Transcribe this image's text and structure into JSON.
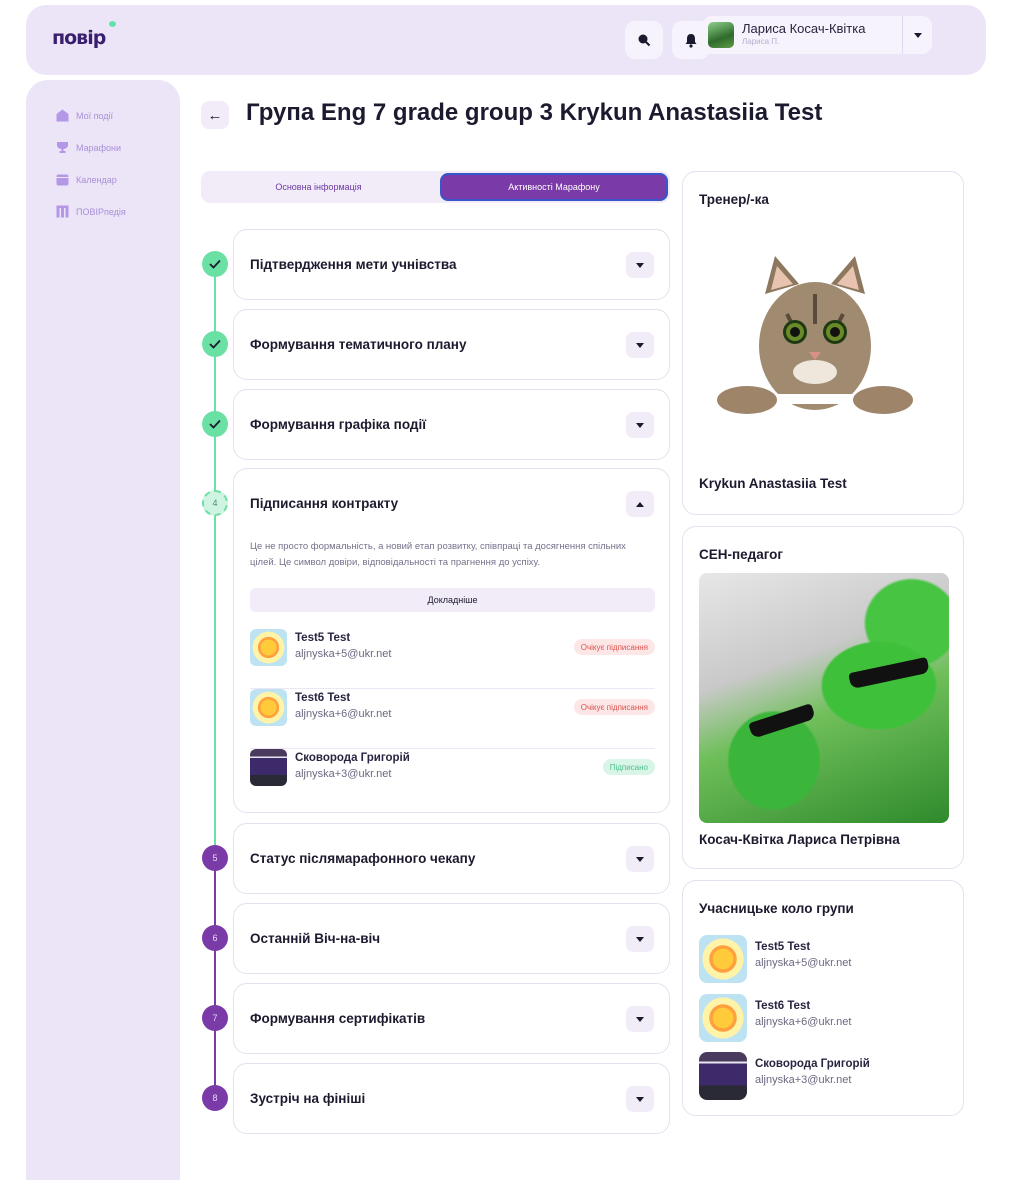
{
  "header": {
    "logo_text": "повір",
    "search_icon": "search-icon",
    "bell_icon": "bell-icon",
    "user_name": "Лариса Косач-Квітка",
    "user_short": "Лариса П."
  },
  "sidebar": {
    "items": [
      {
        "label": "Мої події",
        "icon": "home-icon"
      },
      {
        "label": "Марафони",
        "icon": "trophy-icon"
      },
      {
        "label": "Календар",
        "icon": "calendar-icon"
      },
      {
        "label": "ПОВІРпедія",
        "icon": "book-icon"
      }
    ]
  },
  "page": {
    "title": "Група Eng 7 grade group 3 Krykun Anastasiia Test"
  },
  "tabs": [
    {
      "label": "Основна інформація",
      "active": false
    },
    {
      "label": "Активності Марафону",
      "active": true
    }
  ],
  "steps": [
    {
      "number": "1",
      "title": "Підтвердження мети учнівства",
      "status": "done"
    },
    {
      "number": "2",
      "title": "Формування тематичного плану",
      "status": "done"
    },
    {
      "number": "3",
      "title": "Формування графіка події",
      "status": "done"
    },
    {
      "number": "4",
      "title": "Підписання контракту",
      "status": "current",
      "description": "Це не просто формальність, а новий етап розвитку, співпраці та досягнення спільних цілей. Це символ довіри, відповідальності та прагнення до успіху.",
      "more_label": "Докладніше",
      "members": [
        {
          "name": "Test5 Test",
          "email": "aljnyska+5@ukr.net",
          "status": "Очікує підписання"
        },
        {
          "name": "Test6 Test",
          "email": "aljnyska+6@ukr.net",
          "status": "Очікує підписання"
        },
        {
          "name": "Сковорода Григорій",
          "email": "aljnyska+3@ukr.net",
          "status": "Підписано"
        }
      ]
    },
    {
      "number": "5",
      "title": "Статус післямарафонного чекапу",
      "status": "todo"
    },
    {
      "number": "6",
      "title": "Останній Віч-на-віч",
      "status": "todo"
    },
    {
      "number": "7",
      "title": "Формування сертифікатів",
      "status": "todo"
    },
    {
      "number": "8",
      "title": "Зустріч на фініші",
      "status": "todo"
    }
  ],
  "trainer": {
    "heading": "Тренер/-ка",
    "name": "Krykun Anastasiia Test"
  },
  "sen": {
    "heading": "СЕН-педагог",
    "name": "Косач-Квітка Лариса Петрівна"
  },
  "participants": {
    "heading": "Учасницьке коло групи",
    "items": [
      {
        "name": "Test5 Test",
        "email": "aljnyska+5@ukr.net"
      },
      {
        "name": "Test6 Test",
        "email": "aljnyska+6@ukr.net"
      },
      {
        "name": "Сковорода Григорій",
        "email": "aljnyska+3@ukr.net"
      }
    ]
  },
  "colors": {
    "accent": "#7a3aa7",
    "done": "#6be0a3",
    "header_bg": "#ece4f7"
  }
}
